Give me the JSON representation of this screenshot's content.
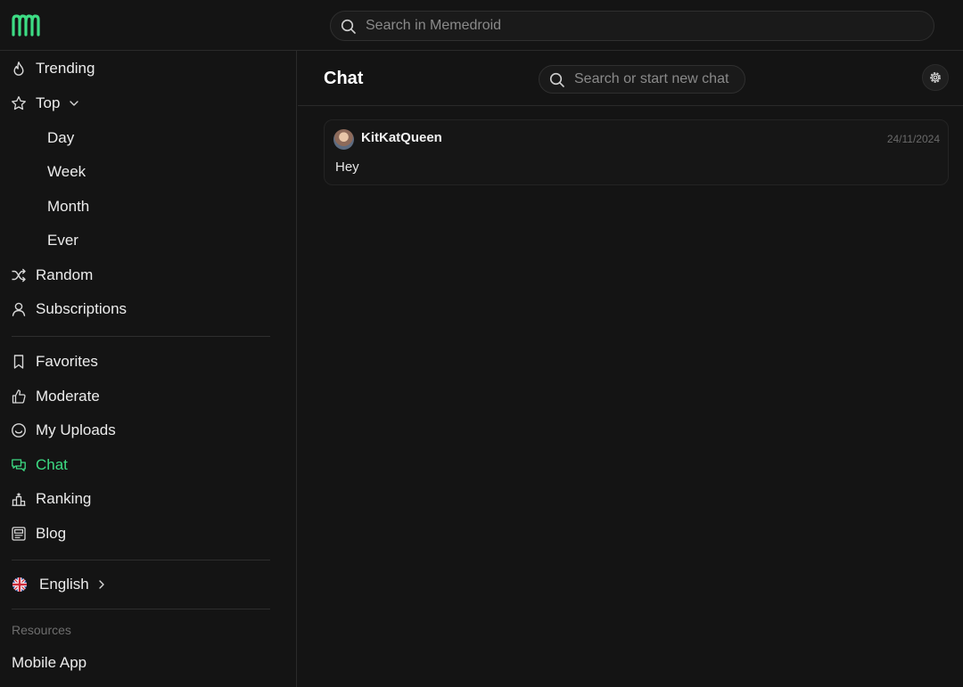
{
  "topbar": {
    "logo_icon": "memedroid-logo-icon",
    "search_placeholder": "Search in Memedroid"
  },
  "sidebar": {
    "items": [
      {
        "label": "Trending",
        "icon": "flame-icon"
      },
      {
        "label": "Top",
        "icon": "star-icon",
        "expanded": true
      },
      {
        "label": "Day"
      },
      {
        "label": "Week"
      },
      {
        "label": "Month"
      },
      {
        "label": "Ever"
      },
      {
        "label": "Random",
        "icon": "shuffle-icon"
      },
      {
        "label": "Subscriptions",
        "icon": "user-icon"
      },
      {
        "label": "Favorites",
        "icon": "bookmark-icon"
      },
      {
        "label": "Moderate",
        "icon": "thumbs-up-icon"
      },
      {
        "label": "My Uploads",
        "icon": "smiley-icon"
      },
      {
        "label": "Chat",
        "icon": "chat-icon",
        "active": true
      },
      {
        "label": "Ranking",
        "icon": "ranking-icon"
      },
      {
        "label": "Blog",
        "icon": "blog-icon"
      }
    ],
    "language": {
      "label": "English",
      "icon": "uk-flag-icon"
    },
    "resources_heading": "Resources",
    "mobile_app": "Mobile App"
  },
  "main": {
    "title": "Chat",
    "search_placeholder": "Search or start new chat",
    "settings_icon": "gear-icon",
    "conversations": [
      {
        "user": "KitKatQueen",
        "date": "24/11/2024",
        "preview": "Hey"
      }
    ]
  },
  "colors": {
    "background": "#141414",
    "accent": "#3ddc84",
    "text": "#ececec",
    "muted": "#6e6e6e"
  }
}
